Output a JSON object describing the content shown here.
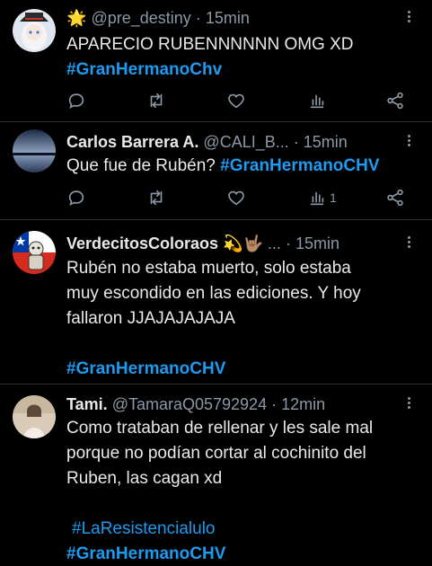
{
  "tweets": [
    {
      "emoji": "🌟",
      "name": "",
      "handle": "@pre_destiny",
      "dot": "·",
      "time": "15min",
      "text_lines": [
        "APARECIO RUBENNNNNN OMG XD"
      ],
      "hashtags": [
        "#GranHermanoChv"
      ],
      "views": ""
    },
    {
      "emoji": "",
      "name": "Carlos Barrera A.",
      "handle": "@CALI_B...",
      "dot": "·",
      "time": "15min",
      "text_lines": [
        "Que fue de Rubén?"
      ],
      "hashtags": [
        "#GranHermanoCHV"
      ],
      "views": "1"
    },
    {
      "emoji": "💫🤟🏽",
      "name": "VerdecitosColoraos",
      "handle": "...",
      "dot": "·",
      "time": "15min",
      "text_lines": [
        "Rubén no estaba muerto, solo estaba",
        "muy escondido en las ediciones. Y hoy",
        "fallaron JJAJAJAJAJA"
      ],
      "hashtags": [
        "#GranHermanoCHV"
      ]
    },
    {
      "emoji": "",
      "name": "Tami.",
      "handle": "@TamaraQ05792924",
      "dot": "·",
      "time": "12min",
      "text_lines": [
        "Como trataban de rellenar y les sale mal",
        "porque no podían cortar al cochinito del",
        "Ruben, las cagan xd"
      ],
      "hashtags": [
        "#LaResistencialulo",
        "#GranHermanoCHV"
      ]
    }
  ],
  "icons": {
    "reply": "reply-bubble-icon",
    "retweet": "retweet-icon",
    "like": "heart-icon",
    "views": "views-bar-chart-icon",
    "share": "share-icon",
    "more": "more-options-icon"
  },
  "colors": {
    "background": "#000000",
    "text": "#e7e9ea",
    "secondary": "#8b98a5",
    "link": "#1d9bf0",
    "divider": "#2f3336"
  }
}
